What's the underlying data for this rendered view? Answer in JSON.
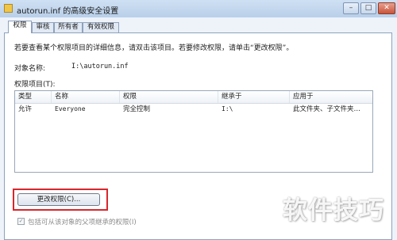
{
  "window": {
    "title": "autorun.inf 的高级安全设置",
    "controls": {
      "minimize": "–",
      "maximize": "□",
      "close": "✕"
    }
  },
  "tabs": [
    {
      "label": "权限",
      "active": true
    },
    {
      "label": "审核",
      "active": false
    },
    {
      "label": "所有者",
      "active": false
    },
    {
      "label": "有效权限",
      "active": false
    }
  ],
  "panel": {
    "intro": "若要查看某个权限项目的详细信息，请双击该项目。若要修改权限，请单击“更改权限”。",
    "object_label": "对象名称:",
    "object_value": "I:\\autorun.inf",
    "entries_label": "权限项目(T):"
  },
  "list": {
    "columns": [
      "类型",
      "名称",
      "权限",
      "继承于",
      "应用于"
    ],
    "rows": [
      {
        "type": "允许",
        "name": "Everyone",
        "permission": "完全控制",
        "inherited_from": "I:\\",
        "applies_to": "此文件夹、子文件夹…"
      }
    ]
  },
  "buttons": {
    "change_permissions": "更改权限(C)..."
  },
  "checkbox": {
    "label": "包括可从该对象的父项继承的权限(I)",
    "checked": true
  },
  "watermark": "软件技巧",
  "colors": {
    "highlight": "#d9262c",
    "titlebar": "#b8cfe9"
  }
}
